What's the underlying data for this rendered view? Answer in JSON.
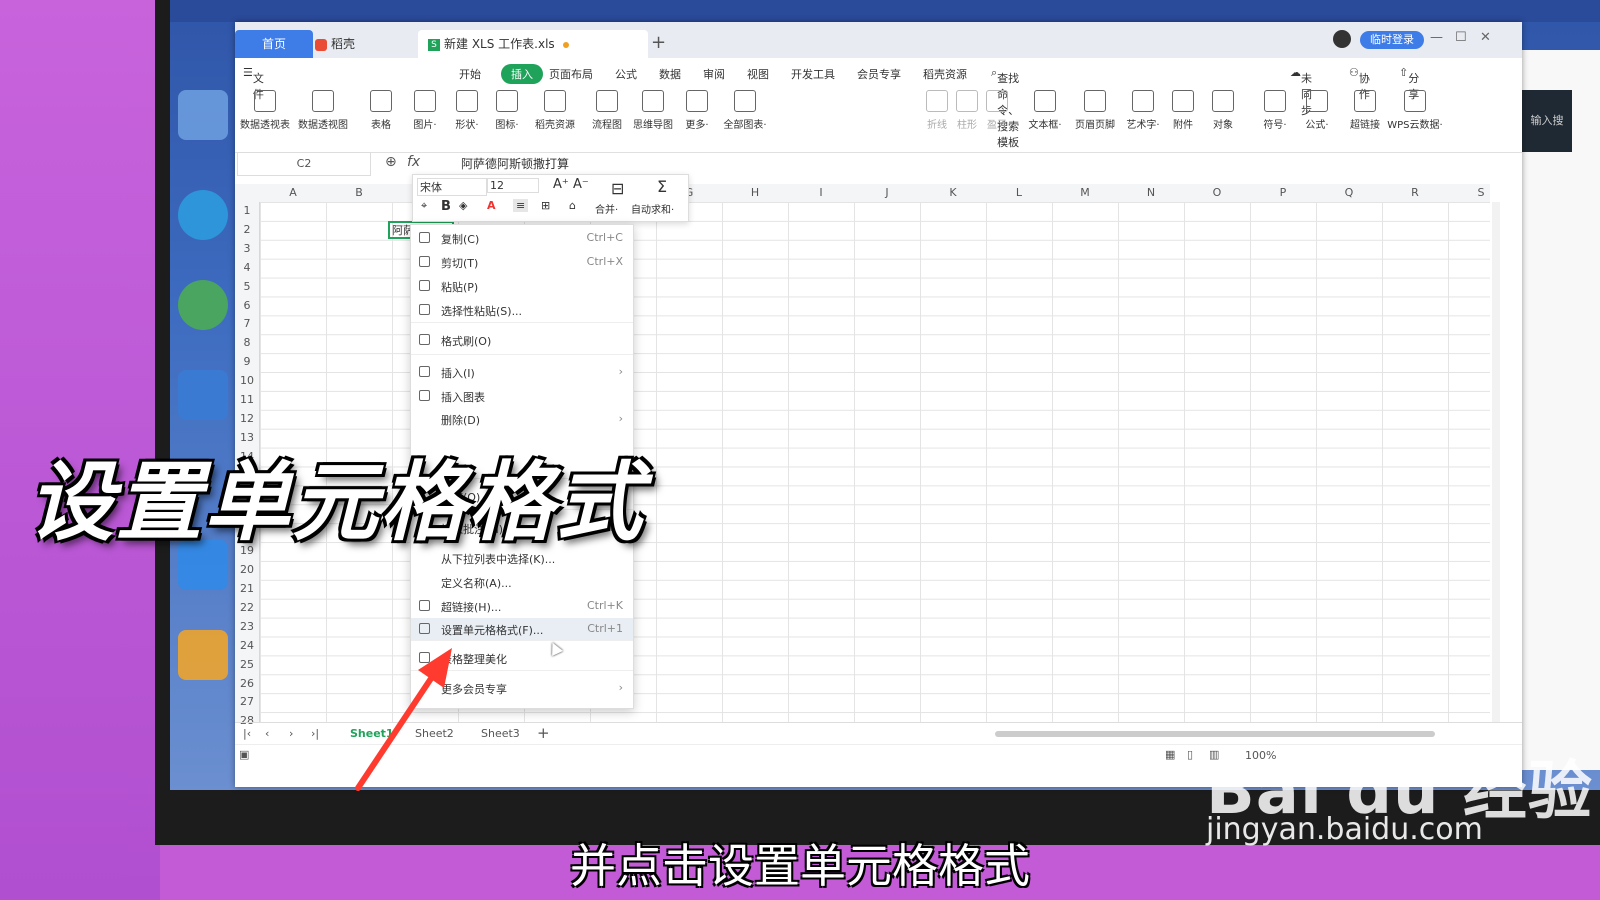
{
  "app": {
    "tabs": {
      "home": "首页",
      "daoke": "稻壳",
      "doc": "新建 XLS 工作表.xls"
    },
    "login": "临时登录"
  },
  "menubar": {
    "file": "文件",
    "items": [
      "开始",
      "插入",
      "页面布局",
      "公式",
      "数据",
      "审阅",
      "视图",
      "开发工具",
      "会员专享",
      "稻壳资源"
    ],
    "active": "插入",
    "search": "查找命令、搜索模板",
    "sync": "未同步",
    "collab": "协作",
    "share": "分享"
  },
  "ribbon": [
    {
      "label": "数据透视表",
      "dim": false
    },
    {
      "label": "数据透视图",
      "dim": false
    },
    {
      "label": "表格",
      "dim": false
    },
    {
      "label": "图片·",
      "dim": false
    },
    {
      "label": "形状·",
      "dim": false
    },
    {
      "label": "图标·",
      "dim": false
    },
    {
      "label": "稻壳资源",
      "dim": false
    },
    {
      "label": "流程图",
      "dim": false
    },
    {
      "label": "思维导图",
      "dim": false
    },
    {
      "label": "更多·",
      "dim": false
    },
    {
      "label": "全部图表·",
      "dim": false
    },
    {
      "label": "折线",
      "dim": true
    },
    {
      "label": "柱形",
      "dim": true
    },
    {
      "label": "盈亏",
      "dim": true
    },
    {
      "label": "文本框·",
      "dim": false
    },
    {
      "label": "页眉页脚",
      "dim": false
    },
    {
      "label": "艺术字·",
      "dim": false
    },
    {
      "label": "附件",
      "dim": false
    },
    {
      "label": "对象",
      "dim": false
    },
    {
      "label": "符号·",
      "dim": false
    },
    {
      "label": "公式·",
      "dim": false
    },
    {
      "label": "超链接",
      "dim": false
    },
    {
      "label": "WPS云数据·",
      "dim": false
    }
  ],
  "formula_bar": {
    "name_box": "C2",
    "fx": "fx",
    "content": "阿萨德阿斯顿撒打算"
  },
  "columns": [
    "A",
    "B",
    "C",
    "D",
    "E",
    "F",
    "G",
    "H",
    "I",
    "J",
    "K",
    "L",
    "M",
    "N",
    "O",
    "P",
    "Q",
    "R",
    "S"
  ],
  "rows": [
    "1",
    "2",
    "3",
    "4",
    "5",
    "6",
    "7",
    "8",
    "9",
    "10",
    "11",
    "12",
    "13",
    "14",
    "15",
    "16",
    "17",
    "18",
    "19",
    "20",
    "21",
    "22",
    "23",
    "24",
    "25",
    "26",
    "27",
    "28"
  ],
  "cell_c2": "阿萨德阿斯顿撒打算",
  "mini_toolbar": {
    "font": "宋体",
    "size": "12",
    "merge": "合并·",
    "autosum": "自动求和·",
    "bold": "B",
    "font_color": "A"
  },
  "context_menu": [
    {
      "label": "复制(C)",
      "shortcut": "Ctrl+C"
    },
    {
      "label": "剪切(T)",
      "shortcut": "Ctrl+X"
    },
    {
      "label": "粘贴(P)",
      "shortcut": ""
    },
    {
      "label": "选择性粘贴(S)...",
      "shortcut": ""
    },
    {
      "label": "格式刷(O)",
      "shortcut": ""
    },
    {
      "label": "插入(I)",
      "shortcut": "›"
    },
    {
      "label": "插入图表",
      "shortcut": ""
    },
    {
      "label": "删除(D)",
      "shortcut": "›"
    },
    {
      "label": "排序(O)",
      "shortcut": ""
    },
    {
      "label": "插入批注(M)",
      "shortcut": "Shift+F2"
    },
    {
      "label": "从下拉列表中选择(K)...",
      "shortcut": ""
    },
    {
      "label": "定义名称(A)...",
      "shortcut": ""
    },
    {
      "label": "超链接(H)...",
      "shortcut": "Ctrl+K"
    },
    {
      "label": "设置单元格格式(F)...",
      "shortcut": "Ctrl+1"
    },
    {
      "label": "表格整理美化",
      "shortcut": ""
    },
    {
      "label": "更多会员专享",
      "shortcut": "›"
    }
  ],
  "sheets": [
    "Sheet1",
    "Sheet2",
    "Sheet3"
  ],
  "status": {
    "zoom": "100%"
  },
  "overlay": {
    "caption": "设置单元格格式",
    "subtitle": "并点击设置单元格格式",
    "watermark": "Bai du 经验",
    "watermark_url": "jingyan.baidu.com"
  },
  "right_panel": {
    "text": "输入搜"
  }
}
